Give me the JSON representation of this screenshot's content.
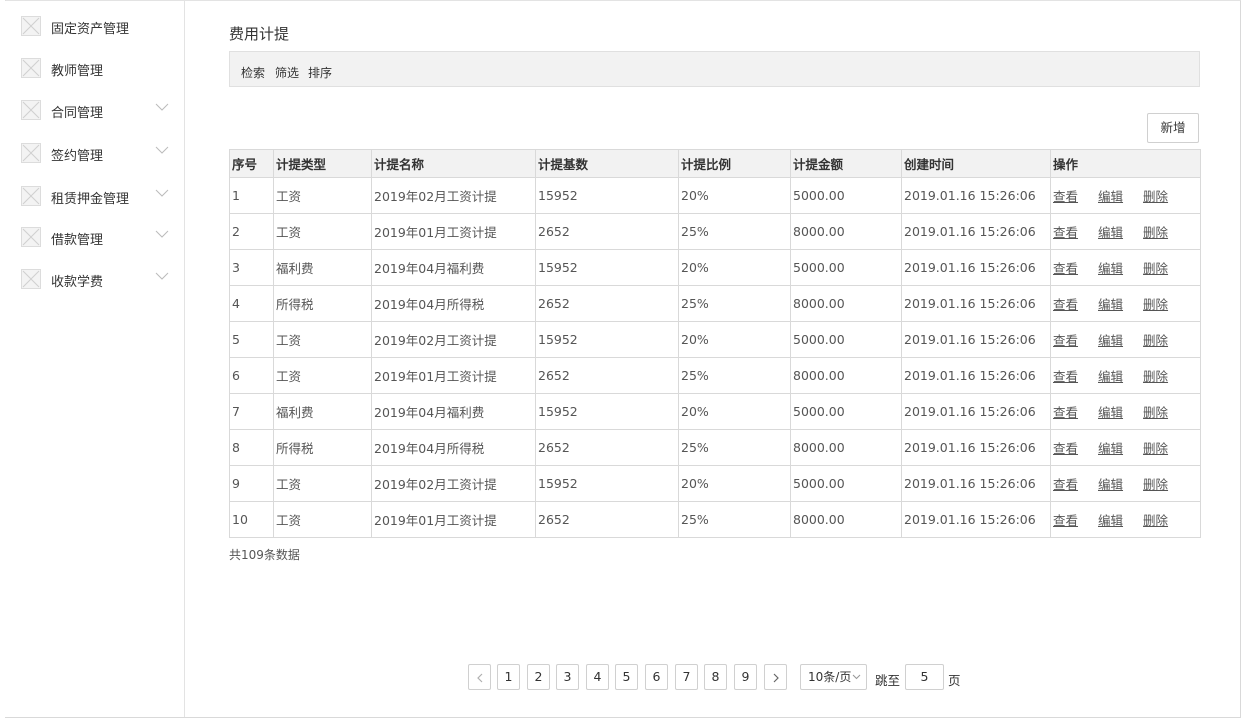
{
  "sidebar": {
    "items": [
      {
        "label": "固定资产管理",
        "icon": "placeholder-image-icon",
        "expandable": false
      },
      {
        "label": "教师管理",
        "icon": "placeholder-image-icon",
        "expandable": false
      },
      {
        "label": "合同管理",
        "icon": "placeholder-image-icon",
        "expandable": true
      },
      {
        "label": "签约管理",
        "icon": "placeholder-image-icon",
        "expandable": true
      },
      {
        "label": "租赁押金管理",
        "icon": "placeholder-image-icon",
        "expandable": true
      },
      {
        "label": "借款管理",
        "icon": "placeholder-image-icon",
        "expandable": true
      },
      {
        "label": "收款学费",
        "icon": "placeholder-image-icon",
        "expandable": true
      }
    ]
  },
  "main": {
    "title": "费用计提",
    "filters": [
      "检索",
      "筛选",
      "排序"
    ],
    "add_label": "新增"
  },
  "table": {
    "headers": [
      "序号",
      "计提类型",
      "计提名称",
      "计提基数",
      "计提比例",
      "计提金额",
      "创建时间",
      "操作"
    ],
    "rows": [
      [
        "1",
        "工资",
        "2019年02月工资计提",
        "15952",
        "20%",
        "5000.00",
        "2019.01.16 15:26:06"
      ],
      [
        "2",
        "工资",
        "2019年01月工资计提",
        "2652",
        "25%",
        "8000.00",
        "2019.01.16 15:26:06"
      ],
      [
        "3",
        "福利费",
        "2019年04月福利费",
        "15952",
        "20%",
        "5000.00",
        "2019.01.16 15:26:06"
      ],
      [
        "4",
        "所得税",
        "2019年04月所得税",
        "2652",
        "25%",
        "8000.00",
        "2019.01.16 15:26:06"
      ],
      [
        "5",
        "工资",
        "2019年02月工资计提",
        "15952",
        "20%",
        "5000.00",
        "2019.01.16 15:26:06"
      ],
      [
        "6",
        "工资",
        "2019年01月工资计提",
        "2652",
        "25%",
        "8000.00",
        "2019.01.16 15:26:06"
      ],
      [
        "7",
        "福利费",
        "2019年04月福利费",
        "15952",
        "20%",
        "5000.00",
        "2019.01.16 15:26:06"
      ],
      [
        "8",
        "所得税",
        "2019年04月所得税",
        "2652",
        "25%",
        "8000.00",
        "2019.01.16 15:26:06"
      ],
      [
        "9",
        "工资",
        "2019年02月工资计提",
        "15952",
        "20%",
        "5000.00",
        "2019.01.16 15:26:06"
      ],
      [
        "10",
        "工资",
        "2019年01月工资计提",
        "2652",
        "25%",
        "8000.00",
        "2019.01.16 15:26:06"
      ]
    ],
    "actions": [
      "查看",
      "编辑",
      "删除"
    ]
  },
  "summary": {
    "total_text": "共109条数据"
  },
  "pagination": {
    "pages": [
      "1",
      "2",
      "3",
      "4",
      "5",
      "6",
      "7",
      "8",
      "9"
    ],
    "prev_icon": "chevron-left-icon",
    "next_icon": "chevron-right-icon",
    "page_size": "10条/页",
    "jump_label": "跳至",
    "jump_value": "5",
    "page_unit": "页"
  }
}
